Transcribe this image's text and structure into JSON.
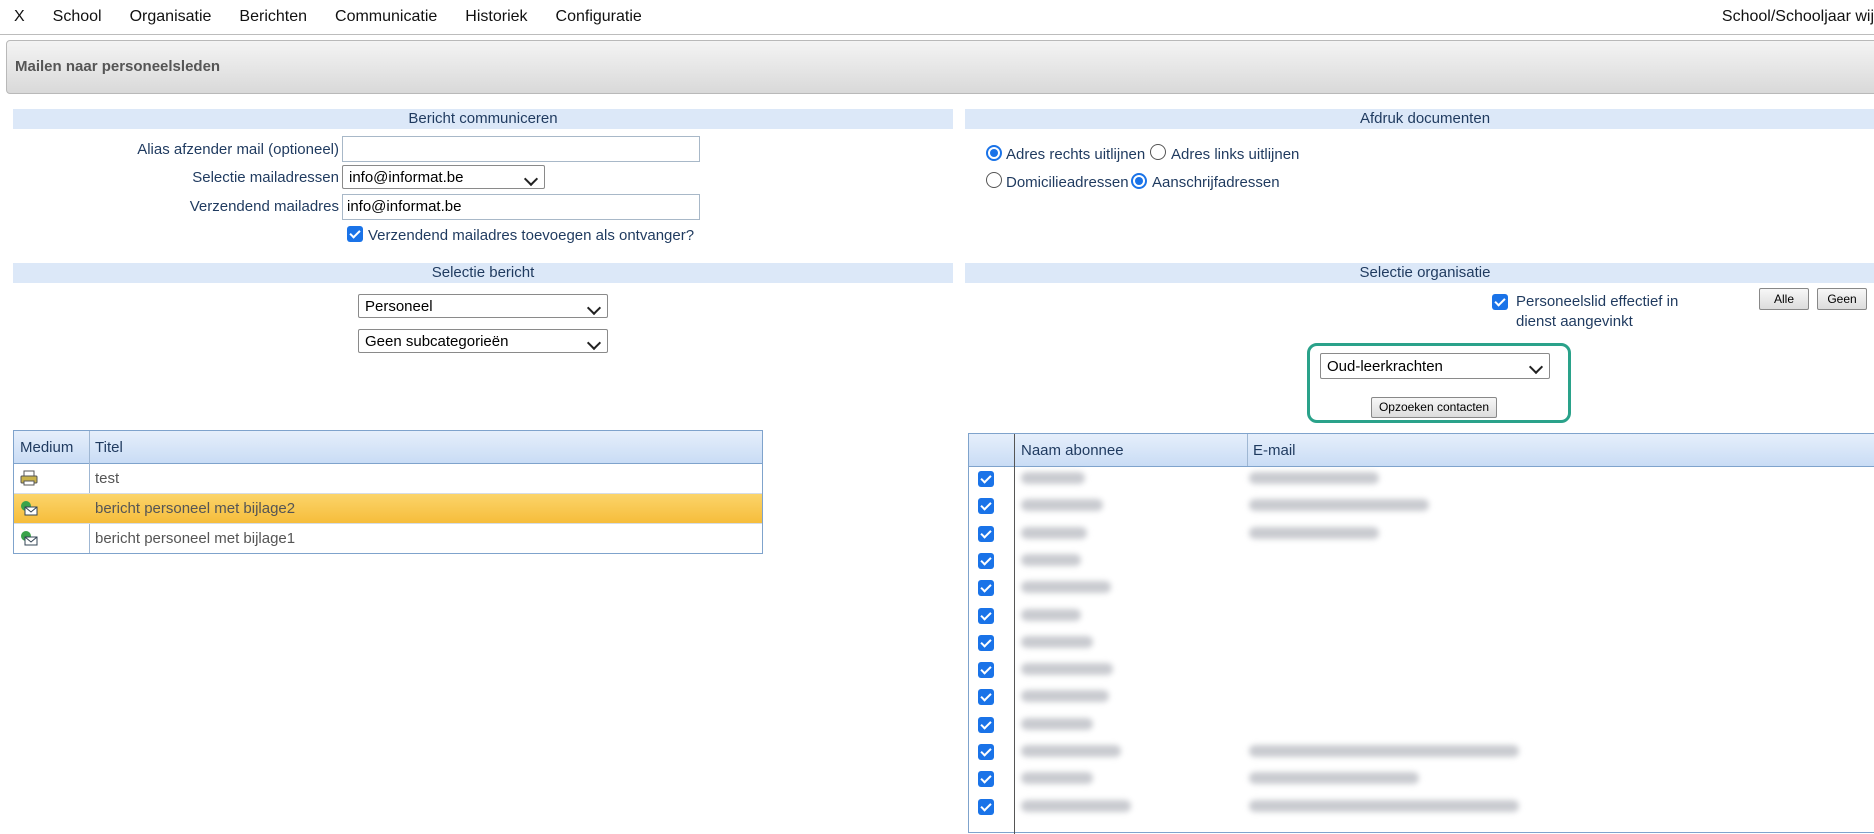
{
  "menu": {
    "items": [
      "X",
      "School",
      "Organisatie",
      "Berichten",
      "Communicatie",
      "Historiek",
      "Configuratie"
    ],
    "right_text": "School/Schooljaar wij"
  },
  "page_title": "Mailen naar personeelsleden",
  "bericht_communiceren": {
    "header": "Bericht communiceren",
    "alias_label": "Alias afzender mail (optioneel)",
    "alias_value": "",
    "selectie_label": "Selectie mailadressen",
    "selectie_value": "info@informat.be",
    "verzendend_label": "Verzendend mailadres",
    "verzendend_value": "info@informat.be",
    "toevoegen_label": "Verzendend mailadres toevoegen als ontvanger?",
    "toevoegen_checked": true
  },
  "afdruk": {
    "header": "Afdruk documenten",
    "adres_rechts": "Adres rechts uitlijnen",
    "adres_links": "Adres links uitlijnen",
    "domicilie": "Domicilieadressen",
    "aanschrijf": "Aanschrijfadressen"
  },
  "selectie_bericht": {
    "header": "Selectie bericht",
    "categorie": "Personeel",
    "subcategorie": "Geen subcategorieën"
  },
  "selectie_organisatie": {
    "header": "Selectie organisatie",
    "effectief_label_1": "Personeelslid effectief in",
    "effectief_label_2": "dienst aangevinkt",
    "alle_button": "Alle",
    "geen_button": "Geen",
    "groep_value": "Oud-leerkrachten",
    "opzoeken_button": "Opzoeken contacten"
  },
  "berichten_table": {
    "headers": [
      "Medium",
      "Titel"
    ],
    "rows": [
      {
        "icon": "printer-icon",
        "title": "test"
      },
      {
        "icon": "mail-icon",
        "title": "bericht personeel met bijlage2"
      },
      {
        "icon": "mail-icon",
        "title": "bericht personeel met bijlage1"
      }
    ]
  },
  "contacten_table": {
    "headers": [
      "Naam abonnee",
      "E-mail"
    ],
    "row_count": 13
  },
  "colors": {
    "accent": "#1a73e8",
    "section_header": "#dce8f8",
    "selected_row": "#f6bd3b",
    "highlight_border": "#2aa28a"
  }
}
